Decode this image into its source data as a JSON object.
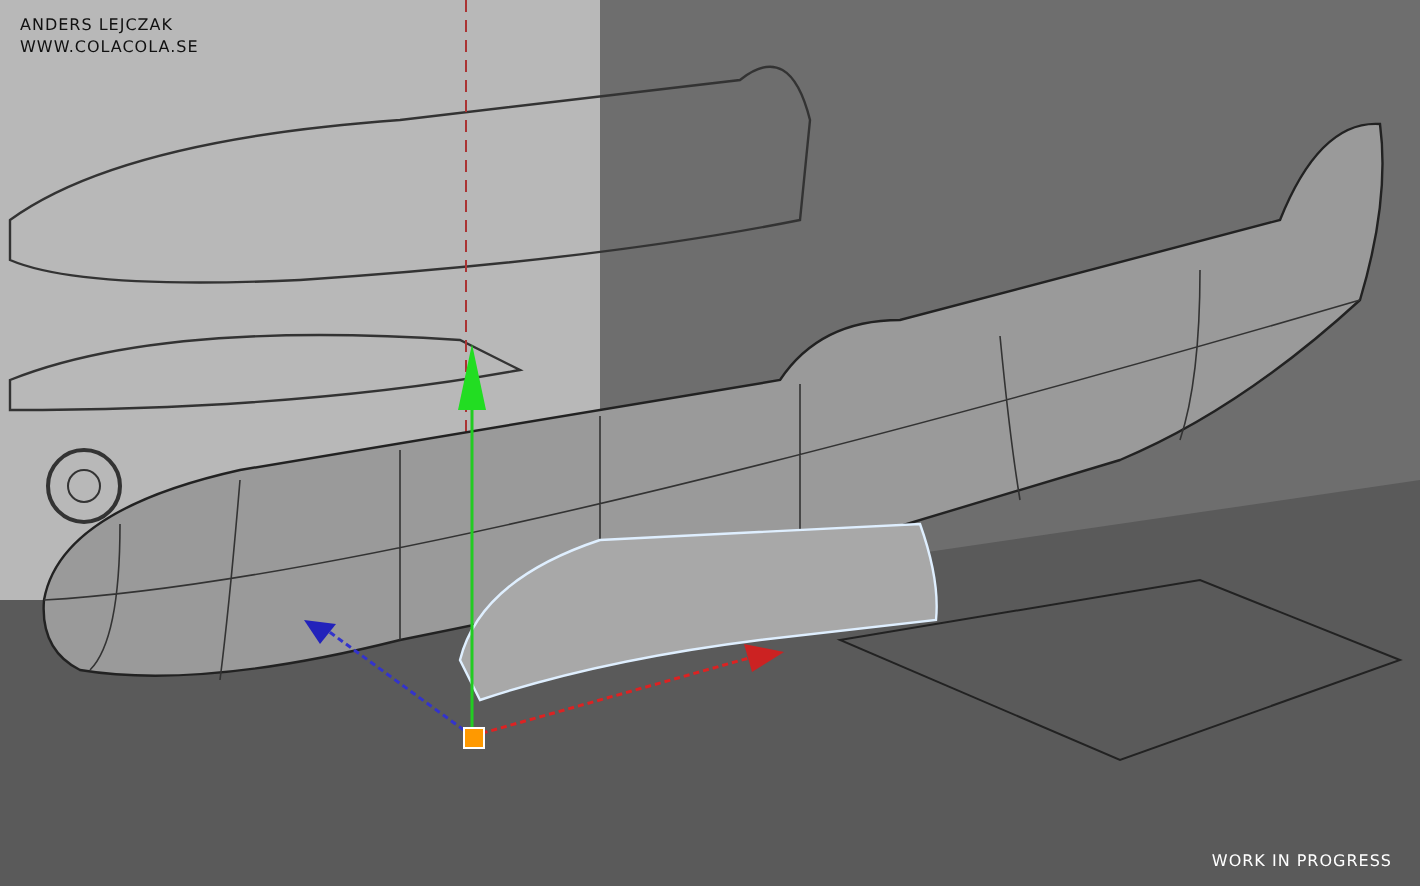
{
  "credits": {
    "author": "ANDERS LEJCZAK",
    "website": "WWW.COLACOLA.SE"
  },
  "status_label": "WORK IN PROGRESS"
}
